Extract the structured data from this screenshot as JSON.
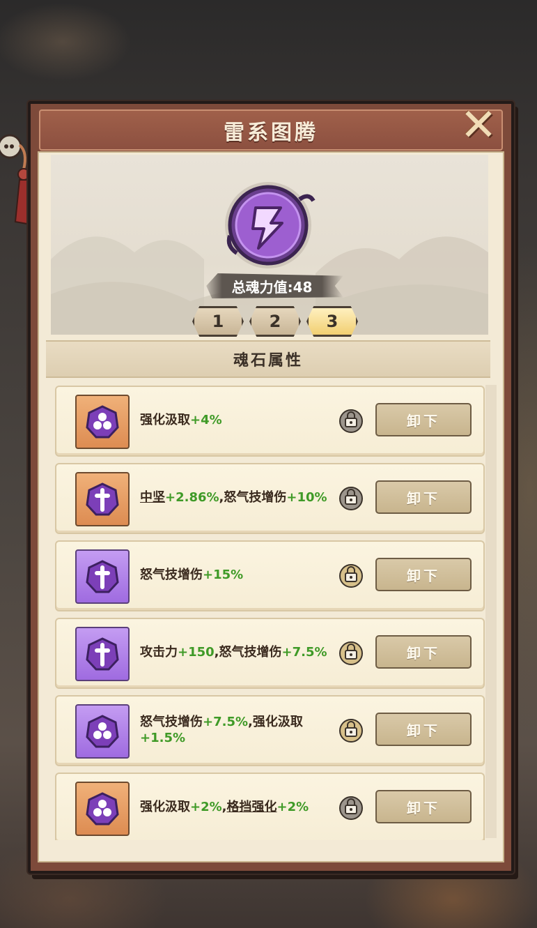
{
  "panel": {
    "title": "雷系图腾",
    "close_icon": "close-icon"
  },
  "totem": {
    "icon": "lightning-emblem-icon",
    "power_label": "总魂力值:48",
    "tabs": [
      {
        "label": "1",
        "active": false
      },
      {
        "label": "2",
        "active": false
      },
      {
        "label": "3",
        "active": true
      }
    ]
  },
  "section": {
    "title": "魂石属性"
  },
  "colors": {
    "green": "#3f9a27",
    "orange_stone": "#dd8c52",
    "purple_stone": "#9f6be0"
  },
  "stones": [
    {
      "rarity": "orange",
      "glyph": "triple-leaf-icon",
      "lock_state": "grey",
      "parts": [
        {
          "text": "强化汲取",
          "style": "normal"
        },
        {
          "text": "+4%",
          "style": "green"
        }
      ],
      "button": "卸下"
    },
    {
      "rarity": "orange",
      "glyph": "sword-icon",
      "lock_state": "grey",
      "parts": [
        {
          "text": "中坚",
          "style": "underline"
        },
        {
          "text": "+2.86%",
          "style": "green"
        },
        {
          "text": ",怒气技增伤",
          "style": "normal"
        },
        {
          "text": "+10%",
          "style": "green"
        }
      ],
      "button": "卸下"
    },
    {
      "rarity": "purple",
      "glyph": "sword-icon",
      "lock_state": "gold",
      "parts": [
        {
          "text": "怒气技增伤",
          "style": "normal"
        },
        {
          "text": "+15%",
          "style": "green"
        }
      ],
      "button": "卸下"
    },
    {
      "rarity": "purple",
      "glyph": "sword-icon",
      "lock_state": "gold",
      "parts": [
        {
          "text": "攻击力",
          "style": "normal"
        },
        {
          "text": "+150",
          "style": "green"
        },
        {
          "text": ",怒气技增伤",
          "style": "normal"
        },
        {
          "text": "+7.5%",
          "style": "green"
        }
      ],
      "button": "卸下"
    },
    {
      "rarity": "purple",
      "glyph": "triple-leaf-icon",
      "lock_state": "gold",
      "parts": [
        {
          "text": "怒气技增伤",
          "style": "normal"
        },
        {
          "text": "+7.5%",
          "style": "green"
        },
        {
          "text": ",强化汲取",
          "style": "normal"
        },
        {
          "text": "+1.5%",
          "style": "green"
        }
      ],
      "button": "卸下"
    },
    {
      "rarity": "orange",
      "glyph": "triple-leaf-icon",
      "lock_state": "grey",
      "parts": [
        {
          "text": "强化汲取",
          "style": "normal"
        },
        {
          "text": "+2%",
          "style": "green"
        },
        {
          "text": ",",
          "style": "normal"
        },
        {
          "text": "格挡强化",
          "style": "underline"
        },
        {
          "text": "+2%",
          "style": "green"
        }
      ],
      "button": "卸下"
    }
  ]
}
